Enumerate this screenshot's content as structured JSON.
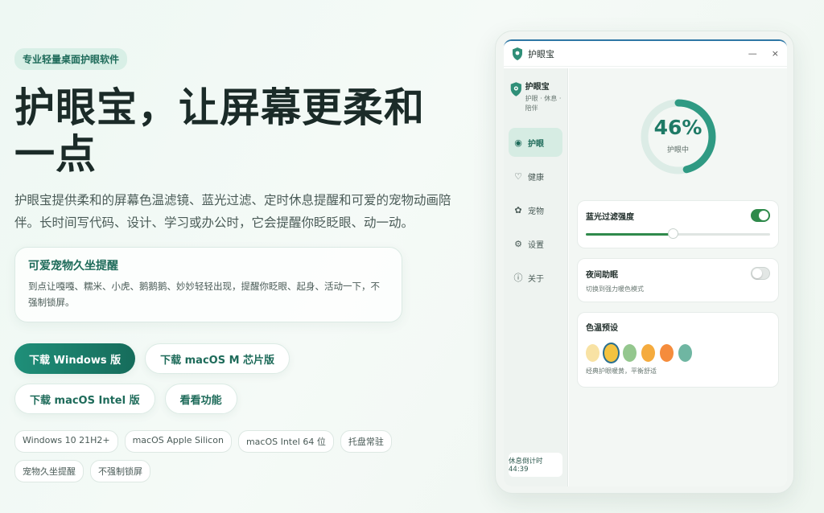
{
  "hero": {
    "tagline": "专业轻量桌面护眼软件",
    "title": "护眼宝，让屏幕更柔和一点",
    "description": "护眼宝提供柔和的屏幕色温滤镜、蓝光过滤、定时休息提醒和可爱的宠物动画陪伴。长时间写代码、设计、学习或办公时，它会提醒你眨眨眼、动一动。",
    "feature_card": {
      "title": "可爱宠物久坐提醒",
      "text": "到点让嘎嘎、糯米、小虎、鹅鹅鹅、妙妙轻轻出现，提醒你眨眼、起身、活动一下，不强制锁屏。"
    },
    "buttons": {
      "windows": "下载 Windows 版",
      "macos_m": "下载 macOS M 芯片版",
      "macos_intel": "下载 macOS Intel 版",
      "features": "看看功能"
    },
    "chips": [
      "Windows 10 21H2+",
      "macOS Apple Silicon",
      "macOS Intel 64 位",
      "托盘常驻",
      "宠物久坐提醒",
      "不强制锁屏"
    ]
  },
  "app": {
    "window_title": "护眼宝",
    "controls": {
      "minimize": "—",
      "close": "×"
    },
    "brand": {
      "name": "护眼宝",
      "subtitle": "护眼 · 休息 · 陪伴"
    },
    "nav": {
      "eye": "护眼",
      "health": "健康",
      "pet": "宠物",
      "settings": "设置",
      "about": "关于"
    },
    "rest_countdown": "休息倒计时 44:39",
    "ring": {
      "value": "46%",
      "percent": 46,
      "label": "护眼中"
    },
    "blue_light": {
      "title": "蓝光过滤强度",
      "enabled": true,
      "level_percent": 47
    },
    "night_mode": {
      "title": "夜间助眠",
      "subtitle": "切换到强力暖色模式",
      "enabled": false
    },
    "color_temp": {
      "title": "色温预设",
      "subtitle": "经典护眼暖黄，平衡舒适",
      "swatches": [
        "#f8e2a4",
        "#f4c340",
        "#94c78e",
        "#f5ab3e",
        "#f58c3c",
        "#6fb6a2"
      ],
      "selected_index": 1
    }
  },
  "colors": {
    "accent": "#1e7a66",
    "brand": "#166c5b"
  }
}
